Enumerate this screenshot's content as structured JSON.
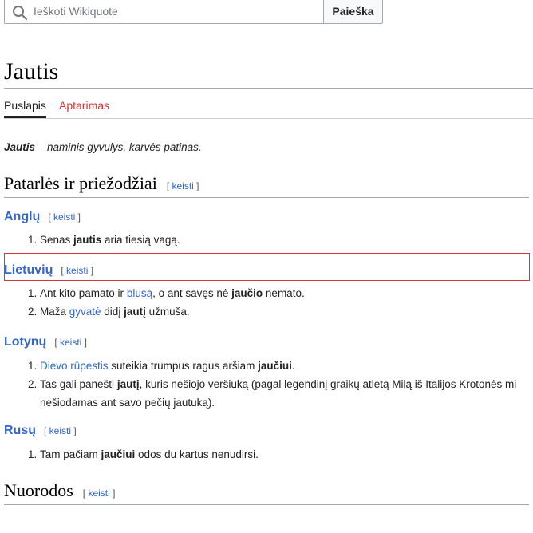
{
  "search": {
    "placeholder": "Ieškoti Wikiquote",
    "button_label": "Paieška"
  },
  "page": {
    "title": "Jautis",
    "tabs": [
      {
        "label": "Puslapis",
        "active": true
      },
      {
        "label": "Aptarimas",
        "active": false
      }
    ],
    "intro_bold": "Jautis",
    "intro_rest": " – naminis gyvulys, karvės patinas."
  },
  "sections": {
    "proverbs": {
      "title": "Patarlės ir priežodžiai",
      "edit": "keisti"
    },
    "english": {
      "title": "Anglų",
      "edit": "keisti",
      "items": [
        {
          "num": "1.",
          "a": "Senas ",
          "b": "jautis",
          "c": " aria tiesią vagą."
        }
      ]
    },
    "lithuanian": {
      "title": "Lietuvių",
      "edit": "keisti",
      "items": [
        {
          "num": "1.",
          "a": "Ant kito pamato ir ",
          "link": "blusą",
          "b": ", o ant savęs nė ",
          "bold": "jaučio",
          "c": " nemato."
        },
        {
          "num": "2.",
          "a": "Maža ",
          "link": "gyvatė",
          "b": " didį ",
          "bold": "jautį",
          "c": " užmuša."
        }
      ]
    },
    "latin": {
      "title": "Lotynų",
      "edit": "keisti",
      "items": [
        {
          "num": "1.",
          "link": "Dievo rūpestis",
          "a": " suteikia trumpus ragus aršiam ",
          "bold": "jaučiui",
          "c": "."
        },
        {
          "num": "2.",
          "a": "Tas gali panešti ",
          "bold": "jautį",
          "b": ", kuris nešiojo veršiuką (pagal legendinį graikų atletą Milą iš Italijos Krotonės mi",
          "c": "nešiodamas ant savo pečių jautuką)."
        }
      ]
    },
    "russian": {
      "title": "Rusų",
      "edit": "keisti",
      "items": [
        {
          "num": "1.",
          "a": "Tam pačiam ",
          "bold": "jaučiui",
          "c": " odos du kartus nenudirsi."
        }
      ]
    },
    "links": {
      "title": "Nuorodos",
      "edit": "keisti"
    }
  },
  "colors": {
    "link": "#3366cc",
    "redlink": "#dd3333",
    "highlight": "#dd3333"
  }
}
